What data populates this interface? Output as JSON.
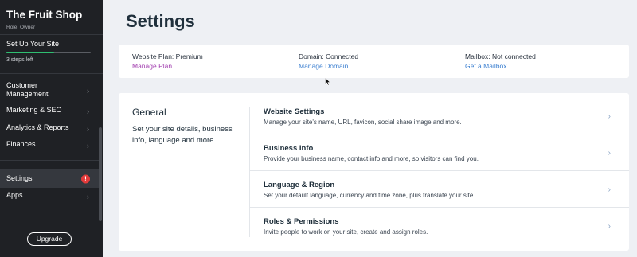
{
  "sidebar": {
    "site_name": "The Fruit Shop",
    "role": "Role: Owner",
    "setup": {
      "title": "Set Up Your Site",
      "steps_left": "3 steps left",
      "progress": 0.57
    },
    "items": [
      {
        "label": "Customer Management"
      },
      {
        "label": "Marketing & SEO"
      },
      {
        "label": "Analytics & Reports"
      },
      {
        "label": "Finances"
      },
      {
        "label": "Settings",
        "badge": "!"
      },
      {
        "label": "Apps"
      }
    ],
    "upgrade_label": "Upgrade"
  },
  "main": {
    "title": "Settings",
    "plan_card": [
      {
        "status": "Website Plan: Premium",
        "link": "Manage Plan",
        "link_color": "#a340b0"
      },
      {
        "status": "Domain: Connected",
        "link": "Manage Domain",
        "link_color": "#3b7fd0"
      },
      {
        "status": "Mailbox: Not connected",
        "link": "Get a Mailbox",
        "link_color": "#3b7fd0"
      }
    ],
    "general": {
      "title": "General",
      "description": "Set your site details, business info, language and more.",
      "rows": [
        {
          "title": "Website Settings",
          "description": "Manage your site's name, URL, favicon, social share image and more."
        },
        {
          "title": "Business Info",
          "description": "Provide your business name, contact info and more, so visitors can find you."
        },
        {
          "title": "Language & Region",
          "description": "Set your default language, currency and time zone, plus translate your site."
        },
        {
          "title": "Roles & Permissions",
          "description": "Invite people to work on your site, create and assign roles."
        }
      ]
    }
  },
  "colors": {
    "sidebar_bg": "#1f2125",
    "progress": "#2fbf71",
    "alert": "#e43b3b",
    "page_bg": "#eef0f4"
  },
  "icons": {
    "nav_chevron": "chevron-right-icon",
    "alert": "alert-icon",
    "cursor": "mouse-pointer-icon"
  }
}
